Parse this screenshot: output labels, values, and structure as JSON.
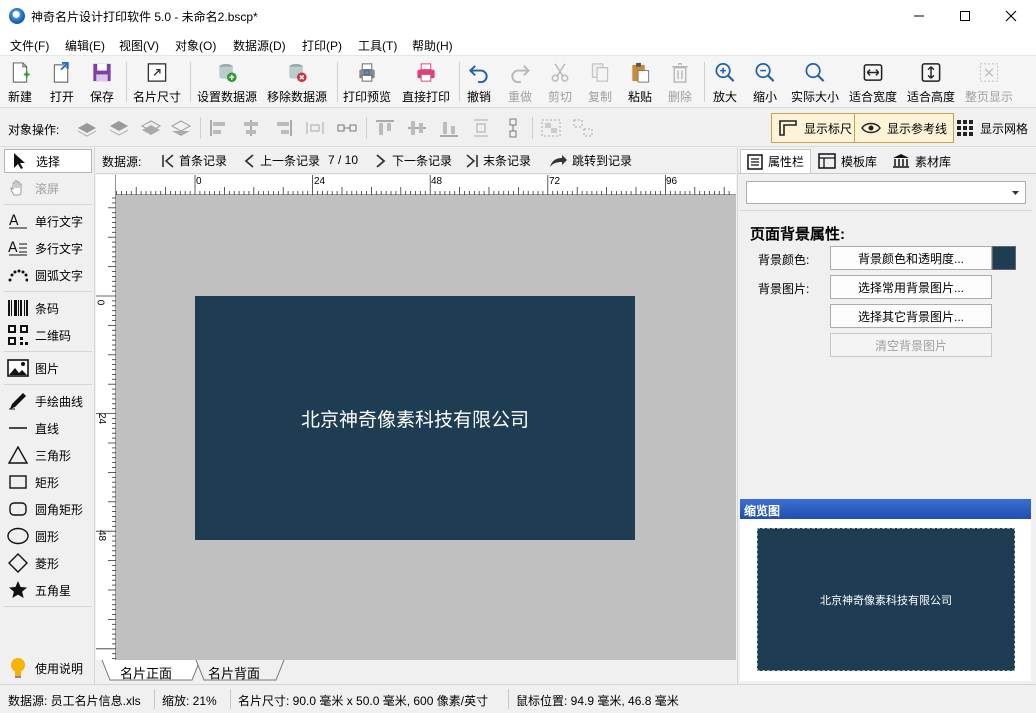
{
  "window": {
    "title": "神奇名片设计打印软件 5.0 - 未命名2.bscp*"
  },
  "menu": [
    "文件(F)",
    "编辑(E)",
    "视图(V)",
    "对象(O)",
    "数据源(D)",
    "打印(P)",
    "工具(T)",
    "帮助(H)"
  ],
  "toolbar": {
    "new": "新建",
    "open": "打开",
    "save": "保存",
    "card_size": "名片尺寸",
    "set_datasource": "设置数据源",
    "remove_datasource": "移除数据源",
    "print_preview": "打印预览",
    "direct_print": "直接打印",
    "undo": "撤销",
    "redo": "重做",
    "cut": "剪切",
    "copy": "复制",
    "paste": "粘贴",
    "delete": "删除",
    "zoom_in": "放大",
    "zoom_out": "缩小",
    "actual_size": "实际大小",
    "fit_width": "适合宽度",
    "fit_height": "适合高度",
    "fit_page": "整页显示"
  },
  "opsbar": {
    "label": "对象操作:",
    "show_ruler": "显示标尺",
    "show_guides": "显示参考线",
    "show_grid": "显示网格"
  },
  "tools": {
    "select": "选择",
    "scroll": "滚屏",
    "single_text": "单行文字",
    "multi_text": "多行文字",
    "arc_text": "圆弧文字",
    "barcode": "条码",
    "qrcode": "二维码",
    "image": "图片",
    "freehand": "手绘曲线",
    "line": "直线",
    "triangle": "三角形",
    "rect": "矩形",
    "round_rect": "圆角矩形",
    "ellipse": "圆形",
    "diamond": "菱形",
    "star": "五角星",
    "help": "使用说明"
  },
  "nav": {
    "label": "数据源:",
    "first": "首条记录",
    "prev": "上一条记录",
    "record": "7 / 10",
    "next": "下一条记录",
    "last": "末条记录",
    "goto": "跳转到记录"
  },
  "ruler": {
    "top": [
      "0",
      "24",
      "48",
      "72",
      "96"
    ],
    "left": [
      "0",
      "24",
      "48"
    ]
  },
  "card": {
    "text": "北京神奇像素科技有限公司",
    "bg_color": "#1e3d52"
  },
  "pagetabs": [
    "名片正面",
    "名片背面"
  ],
  "right": {
    "tabs": [
      "属性栏",
      "模板库",
      "素材库"
    ],
    "props_title": "页面背景属性:",
    "bg_color_label": "背景颜色:",
    "bg_color_btn": "背景颜色和透明度...",
    "bg_image_label": "背景图片:",
    "bg_image_common": "选择常用背景图片...",
    "bg_image_other": "选择其它背景图片...",
    "bg_image_clear": "清空背景图片",
    "thumb_title": "缩览图"
  },
  "status": {
    "datasource": "数据源: 员工名片信息.xls",
    "zoom": "缩放: 21%",
    "size": "名片尺寸: 90.0 毫米 x 50.0 毫米, 600 像素/英寸",
    "mouse": "鼠标位置: 94.9 毫米, 46.8 毫米"
  }
}
